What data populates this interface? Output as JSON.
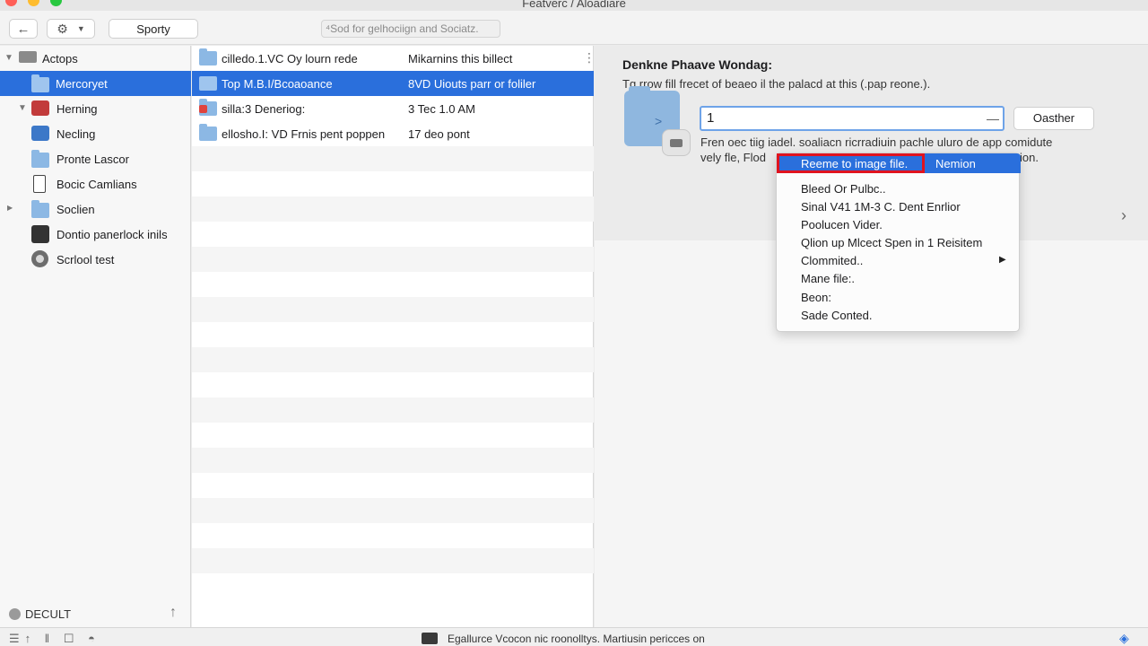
{
  "window": {
    "title": "Featverc / Aloadiare"
  },
  "toolbar": {
    "back_icon": "←",
    "action_icon": "⚙",
    "action_chevron": "▼",
    "sporty_label": "Sporty",
    "search_placeholder": "⁴Sod for gelhociign and Sociatz."
  },
  "sidebar": {
    "items": [
      {
        "label": "Actops",
        "disclosure": "▼"
      },
      {
        "label": "Mercoryet"
      },
      {
        "label": "Herning",
        "disclosure": "▼"
      },
      {
        "label": "Necling"
      },
      {
        "label": "Pronte Lascor"
      },
      {
        "label": "Bocic Camlians"
      },
      {
        "label": "Soclien",
        "disclosure": "▶"
      },
      {
        "label": "Dontio panerlock inils"
      },
      {
        "label": "Scrlool test"
      }
    ],
    "bottom_label": "DECULT",
    "upload_icon": "↑"
  },
  "filelist": {
    "rows": [
      {
        "name": "cilledo.1.VC Oy lourn rede",
        "info": "Mikarnins this billect"
      },
      {
        "name": "Top M.B.I/Bcoaoance",
        "info": "8VD Uiouts parr or foliler"
      },
      {
        "name": "silla:3 Deneriog:",
        "info": "3 Tec 1.0 AM"
      },
      {
        "name": "ellosho.I: VD Frnis pent poppen",
        "info": "17 deo pont"
      }
    ],
    "kebab_icon": "⋮"
  },
  "detail": {
    "title": "Denkne Phaave Wondag:",
    "subtitle": "Tg rrow fill frecet of beaeo il the palacd at this (.pap reone.).",
    "folder_arrow": ">",
    "rename_value": "1",
    "clear_icon": "—",
    "other_button": "Oasther",
    "desc_line1": "Fren oec tiig iadel. soaliacn ricrradiuin pachle uluro de app comidute",
    "desc_line2": "vely fle, Flod",
    "desc_line2_tail": "ion.",
    "next_icon": "›"
  },
  "context_menu": {
    "highlighted": "Reeme to image file.",
    "top_right": "Nemion",
    "items": [
      "Bleed Or Pulbc..",
      "Sinal V41 1M-3 C. Dent Enrlior",
      "Poolucen Vider.",
      "Qlion up Mlcect Spen in 1 Reisitem",
      "Clommited..",
      "Mane file:.",
      "Beon:",
      "Sade Conted."
    ],
    "submenu_icon": "▶"
  },
  "statusbar": {
    "left_icons": "☰↑ ‖ ☐ ◓",
    "text": "Egallurce Vcocon nic roonolltys. Martiusin pericces on",
    "right_icon": "◈"
  }
}
